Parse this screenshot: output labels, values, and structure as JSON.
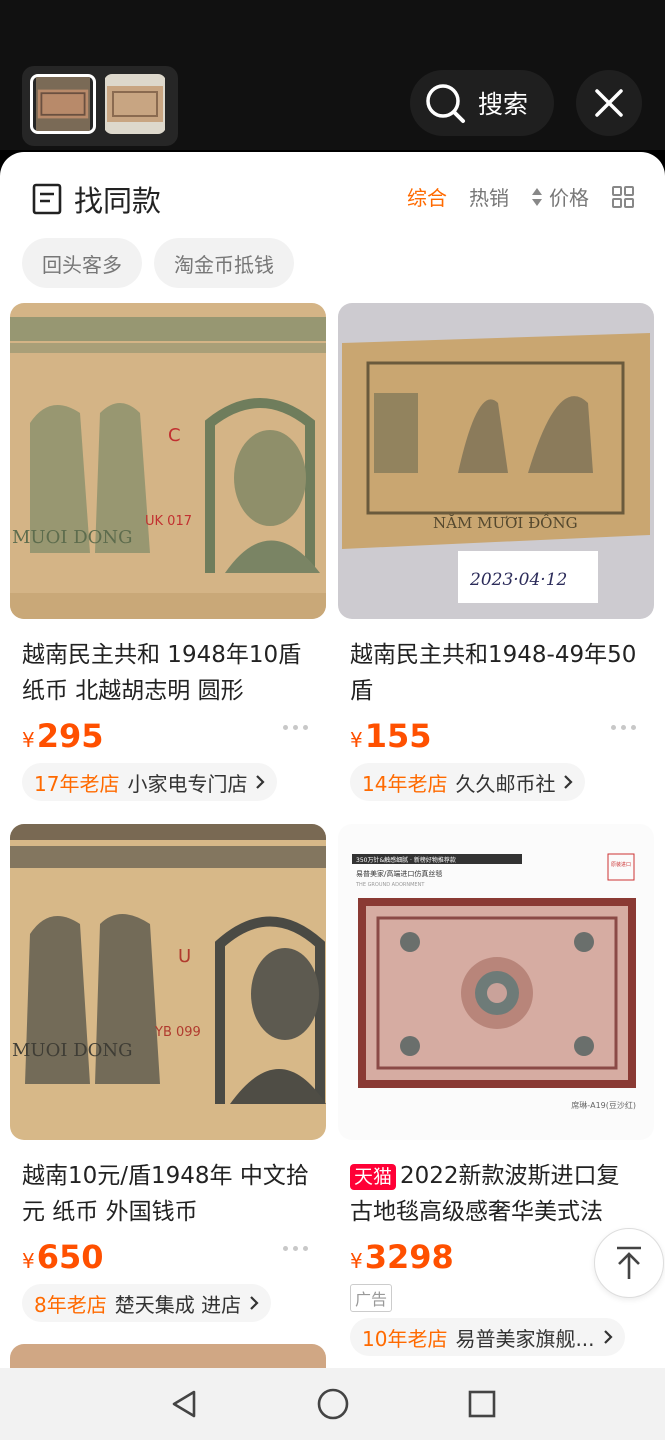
{
  "top": {
    "search_label": "搜索",
    "thumbnails": [
      {
        "icon": "banknote-thumbnail",
        "selected": true
      },
      {
        "icon": "banknote-thumbnail",
        "selected": false
      }
    ]
  },
  "sheet": {
    "title": "找同款",
    "sorts": {
      "comprehensive": "综合",
      "bestselling": "热销",
      "price": "价格"
    },
    "chips": [
      "回头客多",
      "淘金币抵钱"
    ]
  },
  "products": [
    {
      "name": "越南民主共和 1948年10盾 纸币 北越胡志明 圆形",
      "currency": "¥",
      "price": "295",
      "shop_age": "17年老店",
      "shop_name": "小家电专门店"
    },
    {
      "name": "越南民主共和1948-49年50盾",
      "currency": "¥",
      "price": "155",
      "shop_age": "14年老店",
      "shop_name": "久久邮币社",
      "photo_text": {
        "line1": "NĂM MƯƠI ĐỒNG",
        "date": "2023·04·12"
      }
    },
    {
      "name": "越南10元/盾1948年 中文拾元 纸币 外国钱币",
      "currency": "¥",
      "price": "650",
      "shop_age": "8年老店",
      "shop_name": "楚天集成 进店"
    },
    {
      "badge": "天猫",
      "name": "2022新款波斯进口复古地毯高级感奢华美式法",
      "currency": "¥",
      "price": "3298",
      "ad": "广告",
      "shop_age": "10年老店",
      "shop_name": "易普美家旗舰...",
      "photo_text": {
        "banner": "350万针&触感细腻 · 新榜好物推荐款",
        "brand": "易普美家/高端进口仿真丝毯",
        "sub": "THE GROUND ADORNMENT",
        "stamp": "原装进口",
        "caption": "席琳-A19(豆沙红)"
      }
    }
  ],
  "colors": {
    "accent": "#ff6a00",
    "price": "#ff5000",
    "tmall": "#ff0036"
  }
}
